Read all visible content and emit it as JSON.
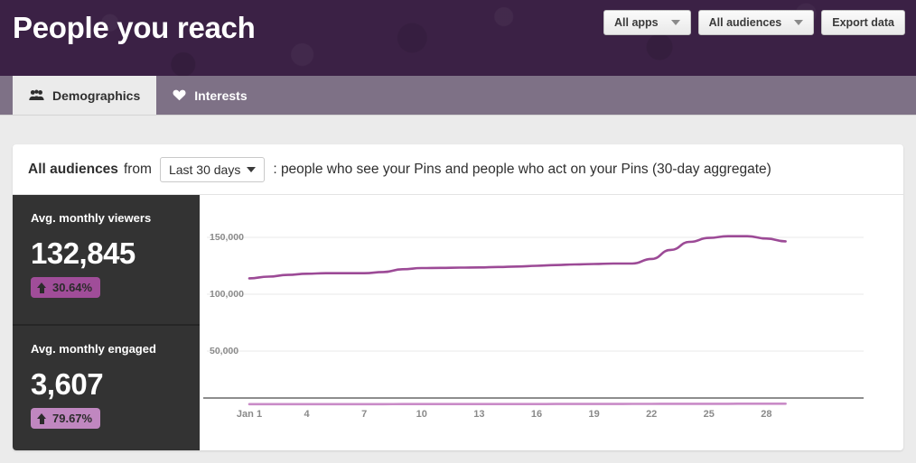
{
  "header": {
    "title": "People you reach",
    "controls": [
      {
        "label": "All apps",
        "icon": "chevron-down-icon",
        "has_caret": true
      },
      {
        "label": "All audiences",
        "icon": "chevron-down-icon",
        "has_caret": true
      },
      {
        "label": "Export data",
        "has_caret": false
      }
    ]
  },
  "tabs": [
    {
      "label": "Demographics",
      "icon": "people-icon",
      "active": true
    },
    {
      "label": "Interests",
      "icon": "heart-icon",
      "active": false
    }
  ],
  "filter_bar": {
    "audience": "All audiences",
    "from_word": "from",
    "range_value": "Last 30 days",
    "description": ": people who see your Pins and people who act on your Pins (30-day aggregate)"
  },
  "metrics": [
    {
      "label": "Avg. monthly viewers",
      "value": "132,845",
      "change": "30.64%",
      "direction": "up",
      "badge_color": "#a04d99"
    },
    {
      "label": "Avg. monthly engaged",
      "value": "3,607",
      "change": "79.67%",
      "direction": "up",
      "badge_color": "#c087c0"
    }
  ],
  "chart_data": {
    "type": "line",
    "title": "",
    "xlabel": "",
    "ylabel": "",
    "grid": true,
    "legend": "none",
    "x_tick_labels": [
      "Jan 1",
      "4",
      "7",
      "10",
      "13",
      "16",
      "19",
      "22",
      "25",
      "28"
    ],
    "y_tick_labels": [
      "150,000",
      "100,000",
      "50,000"
    ],
    "y_ticks": [
      150000,
      100000,
      50000
    ],
    "ylim": [
      0,
      175000
    ],
    "xlim": [
      1,
      31
    ],
    "series": [
      {
        "name": "Avg. monthly viewers",
        "color": "#9c4a96",
        "x": [
          1,
          2,
          3,
          4,
          5,
          6,
          7,
          8,
          9,
          10,
          11,
          12,
          13,
          14,
          15,
          16,
          17,
          18,
          19,
          20,
          21,
          22,
          23,
          24,
          25,
          26,
          27,
          28,
          29
        ],
        "values": [
          114000,
          115500,
          117000,
          118000,
          118500,
          118500,
          118500,
          119500,
          122000,
          123000,
          123200,
          123400,
          123600,
          124000,
          124400,
          125000,
          125600,
          126200,
          126600,
          127000,
          127000,
          131000,
          139000,
          146000,
          149500,
          151000,
          151000,
          149000,
          146500
        ]
      },
      {
        "name": "Avg. monthly engaged",
        "color": "#c98bc7",
        "x": [
          1,
          2,
          3,
          4,
          5,
          6,
          7,
          8,
          9,
          10,
          11,
          12,
          13,
          14,
          15,
          16,
          17,
          18,
          19,
          20,
          21,
          22,
          23,
          24,
          25,
          26,
          27,
          28,
          29
        ],
        "values": [
          3300,
          3310,
          3320,
          3330,
          3340,
          3350,
          3360,
          3370,
          3380,
          3390,
          3400,
          3410,
          3420,
          3430,
          3440,
          3450,
          3460,
          3470,
          3480,
          3500,
          3540,
          3600,
          3640,
          3660,
          3680,
          3690,
          3700,
          3710,
          3720
        ]
      }
    ]
  }
}
